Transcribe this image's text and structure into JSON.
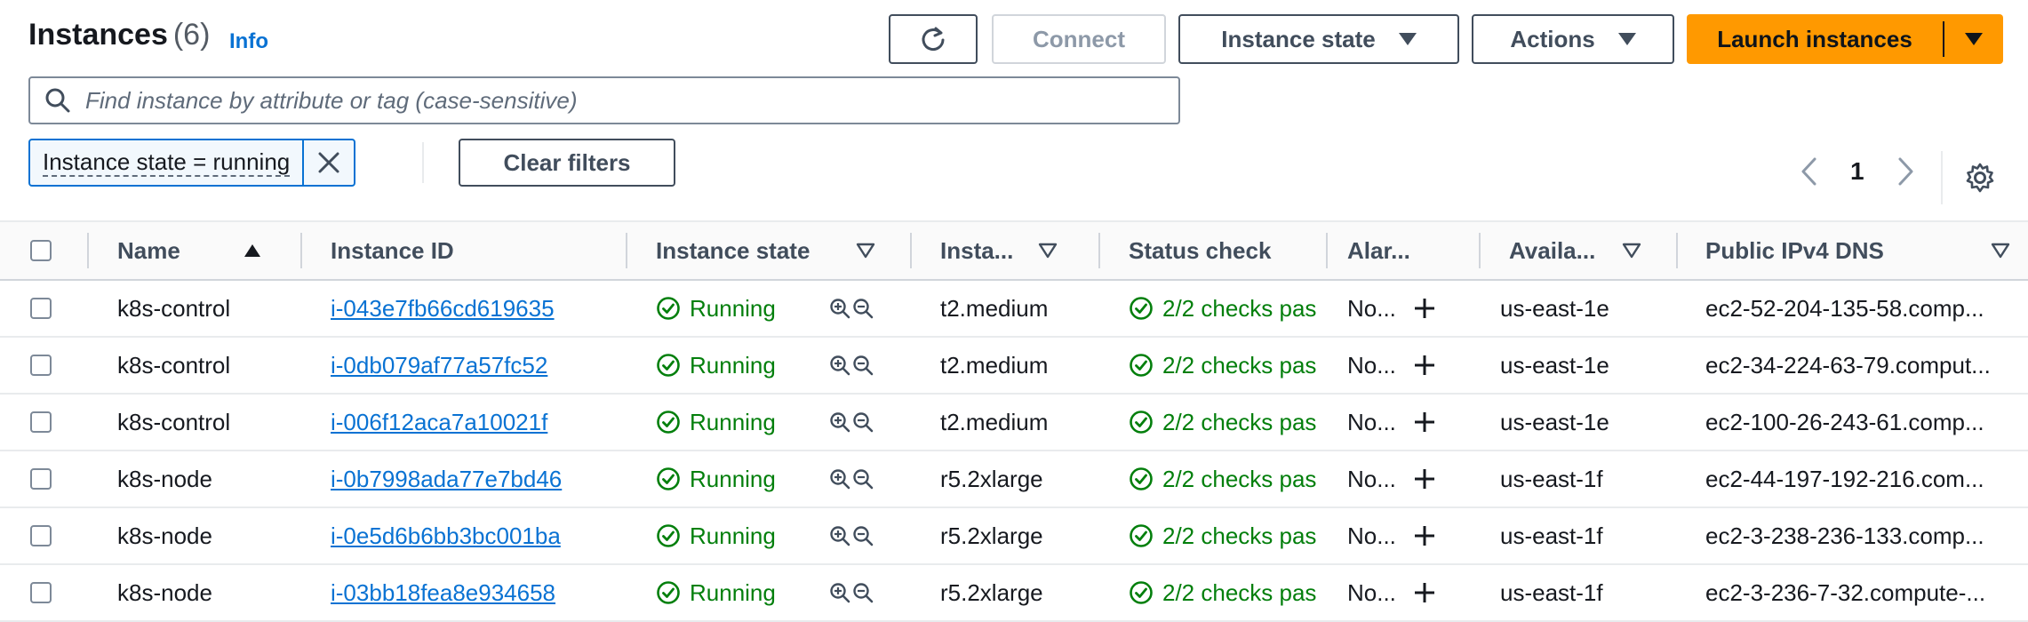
{
  "header": {
    "title": "Instances",
    "count": "(6)",
    "info": "Info"
  },
  "toolbar": {
    "connect": "Connect",
    "instance_state": "Instance state",
    "actions": "Actions",
    "launch": "Launch instances"
  },
  "search": {
    "placeholder": "Find instance by attribute or tag (case-sensitive)"
  },
  "filter": {
    "token": "Instance state = running",
    "clear": "Clear filters"
  },
  "pagination": {
    "page": "1"
  },
  "table": {
    "columns": {
      "name": "Name",
      "instance_id": "Instance ID",
      "instance_state": "Instance state",
      "instance_type": "Insta...",
      "status_check": "Status check",
      "alarm": "Alar...",
      "availability": "Availa...",
      "dns": "Public IPv4 DNS"
    },
    "rows": [
      {
        "name": "k8s-control",
        "id": "i-043e7fb66cd619635",
        "state": "Running",
        "type": "t2.medium",
        "status": "2/2 checks pas",
        "alarm": "No...",
        "az": "us-east-1e",
        "dns": "ec2-52-204-135-58.comp..."
      },
      {
        "name": "k8s-control",
        "id": "i-0db079af77a57fc52",
        "state": "Running",
        "type": "t2.medium",
        "status": "2/2 checks pas",
        "alarm": "No...",
        "az": "us-east-1e",
        "dns": "ec2-34-224-63-79.comput..."
      },
      {
        "name": "k8s-control",
        "id": "i-006f12aca7a10021f",
        "state": "Running",
        "type": "t2.medium",
        "status": "2/2 checks pas",
        "alarm": "No...",
        "az": "us-east-1e",
        "dns": "ec2-100-26-243-61.comp..."
      },
      {
        "name": "k8s-node",
        "id": "i-0b7998ada77e7bd46",
        "state": "Running",
        "type": "r5.2xlarge",
        "status": "2/2 checks pas",
        "alarm": "No...",
        "az": "us-east-1f",
        "dns": "ec2-44-197-192-216.com..."
      },
      {
        "name": "k8s-node",
        "id": "i-0e5d6b6bb3bc001ba",
        "state": "Running",
        "type": "r5.2xlarge",
        "status": "2/2 checks pas",
        "alarm": "No...",
        "az": "us-east-1f",
        "dns": "ec2-3-238-236-133.comp..."
      },
      {
        "name": "k8s-node",
        "id": "i-03bb18fea8e934658",
        "state": "Running",
        "type": "r5.2xlarge",
        "status": "2/2 checks pas",
        "alarm": "No...",
        "az": "us-east-1f",
        "dns": "ec2-3-236-7-32.compute-..."
      }
    ]
  },
  "colors": {
    "accent": "#0972d3",
    "primary_button": "#ff9900",
    "success": "#037f0c"
  },
  "icons": [
    "refresh-icon",
    "caret-down-icon",
    "search-icon",
    "close-icon",
    "chevron-left-icon",
    "chevron-right-icon",
    "gear-icon",
    "sort-ascending-icon",
    "sort-descending-icon",
    "check-circle-icon",
    "zoom-in-icon",
    "zoom-out-icon",
    "plus-icon"
  ]
}
